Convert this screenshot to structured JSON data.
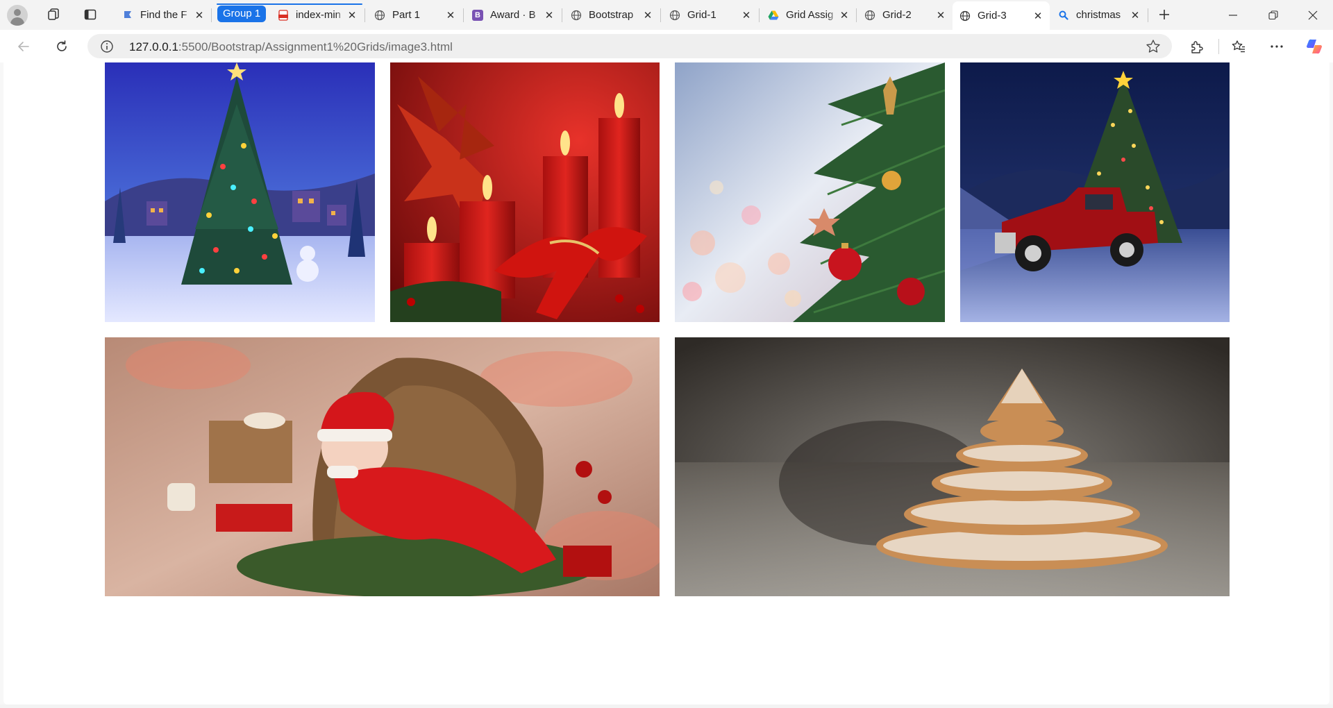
{
  "tabs": [
    {
      "title": "Find the F",
      "favicon": "bookmark-flag-icon",
      "active": false
    },
    {
      "title": "index-min",
      "favicon": "pdf-icon",
      "active": false,
      "group": "Group 1"
    },
    {
      "title": "Part 1",
      "favicon": "globe-icon",
      "active": false
    },
    {
      "title": "Award · B",
      "favicon": "bootstrap-icon",
      "active": false
    },
    {
      "title": "Bootstrap",
      "favicon": "globe-icon",
      "active": false
    },
    {
      "title": "Grid-1",
      "favicon": "globe-icon",
      "active": false
    },
    {
      "title": "Grid Assig",
      "favicon": "google-drive-icon",
      "active": false
    },
    {
      "title": "Grid-2",
      "favicon": "globe-icon",
      "active": false
    },
    {
      "title": "Grid-3",
      "favicon": "globe-icon",
      "active": true
    },
    {
      "title": "christmas",
      "favicon": "search-icon",
      "active": false
    }
  ],
  "tab_group": {
    "label": "Group 1",
    "color": "#1a73e8"
  },
  "address": {
    "host": "127.0.0.1",
    "path": ":5500/Bootstrap/Assignment1%20Grids/image3.html"
  },
  "gallery": {
    "row1": [
      "christmas-tree-village",
      "red-christmas-candles",
      "ornament-tree-bokeh",
      "red-truck-christmas-tree"
    ],
    "row2": [
      "newborn-santa-baby",
      "gingerbread-cookie-tree"
    ]
  },
  "colors": {
    "accent": "#1a73e8",
    "tabstrip": "#f3f3f3",
    "page": "#ffffff"
  }
}
